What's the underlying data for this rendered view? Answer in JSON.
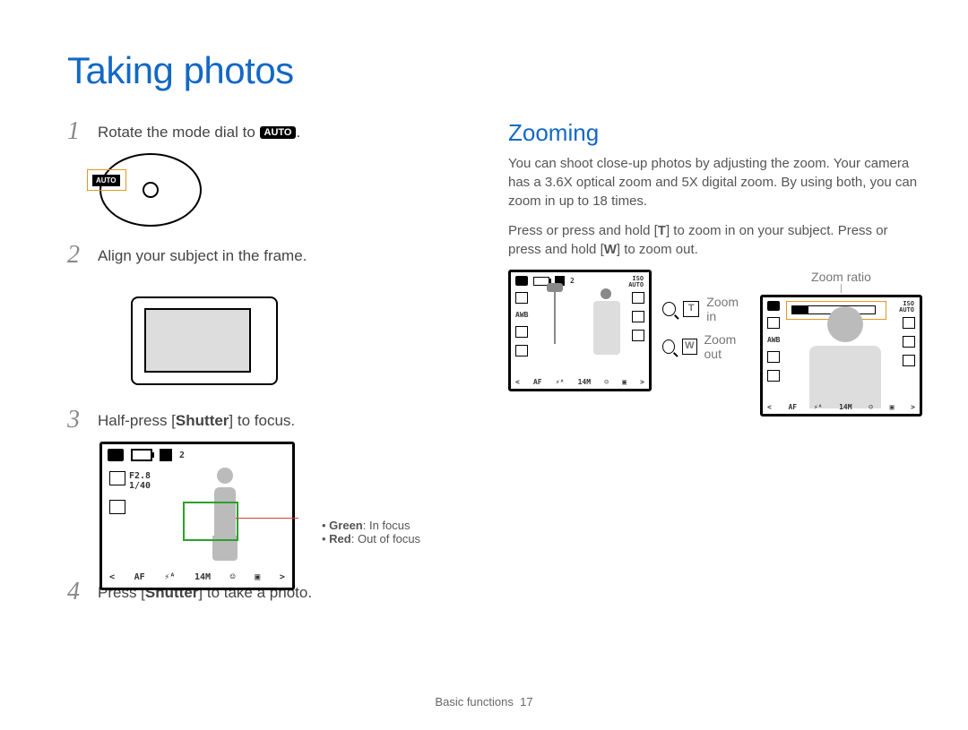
{
  "page_title": "Taking photos",
  "steps": [
    {
      "num": "1",
      "pre": "Rotate the mode dial to ",
      "badge": "AUTO",
      "post": "."
    },
    {
      "num": "2",
      "pre": "Align your subject in the frame.",
      "badge": "",
      "post": ""
    },
    {
      "num": "3",
      "pre": "Half-press [",
      "bold": "Shutter",
      "post": "] to focus."
    },
    {
      "num": "4",
      "pre": "Press [",
      "bold": "Shutter",
      "post": "] to take a photo."
    }
  ],
  "lcd": {
    "count": "2",
    "f": "F2.8",
    "shutter": "1/40",
    "af": "AF",
    "size": "14M"
  },
  "focus_notes": {
    "green_label": "Green",
    "green_text": ": In focus",
    "red_label": "Red",
    "red_text": ": Out of focus"
  },
  "zoom": {
    "heading": "Zooming",
    "para1": "You can shoot close-up photos by adjusting the zoom. Your camera has a 3.6X optical zoom and 5X digital zoom. By using both, you can zoom in up to 18 times.",
    "para2_a": "Press or press and hold [",
    "para2_t": "T",
    "para2_b": "] to zoom in on your subject. Press or press and hold [",
    "para2_w": "W",
    "para2_c": "] to zoom out.",
    "ratio_label": "Zoom ratio",
    "zoom_in": "Zoom in",
    "zoom_out": "Zoom out",
    "btn_t": "T",
    "btn_w": "W",
    "mini": {
      "count": "2",
      "iso1": "ISO",
      "iso2": "AUTO",
      "af": "AF",
      "size": "14M",
      "awb": "AWB"
    }
  },
  "footer_section": "Basic functions",
  "footer_page": "17"
}
